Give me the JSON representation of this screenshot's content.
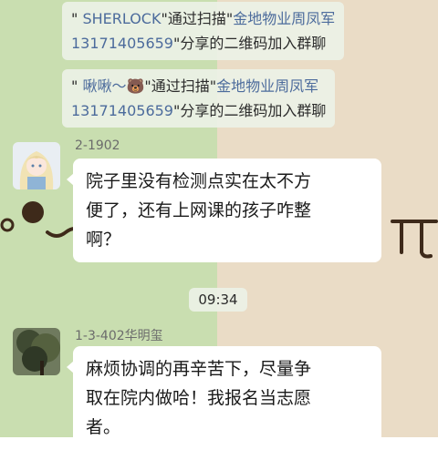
{
  "system_messages": [
    {
      "line1": {
        "q1": "\" ",
        "name": "SHERLOCK",
        "mid": "\"通过扫描\"",
        "owner": "金地物业周凤军"
      },
      "line2": {
        "phone": "13171405659",
        "tail": "\"分享的二维码加入群聊"
      }
    },
    {
      "line1": {
        "q1": "\" ",
        "name": "啾啾～",
        "emoji": "🐻",
        "mid": "\"通过扫描\"",
        "owner": "金地物业周凤军"
      },
      "line2": {
        "phone": "13171405659",
        "tail": "\"分享的二维码加入群聊"
      }
    }
  ],
  "messages": [
    {
      "sender": "2-1902",
      "lines": [
        "院子里没有检测点实在太不方",
        "便了，还有上网课的孩子咋整",
        "啊？"
      ]
    },
    {
      "sender": "1-3-402华明玺",
      "lines": [
        "麻烦协调的再辛苦下，尽量争",
        "取在院内做哈！我报名当志愿",
        "者。"
      ]
    }
  ],
  "timestamp": "09:34",
  "colors": {
    "left_bg": "#c9deb0",
    "right_bg": "#eadcc6",
    "link": "#4c6b9c",
    "bubble": "#ffffff"
  },
  "icons": {
    "avatar1": "anime-girl-avatar",
    "avatar2": "tree-photo-avatar"
  }
}
